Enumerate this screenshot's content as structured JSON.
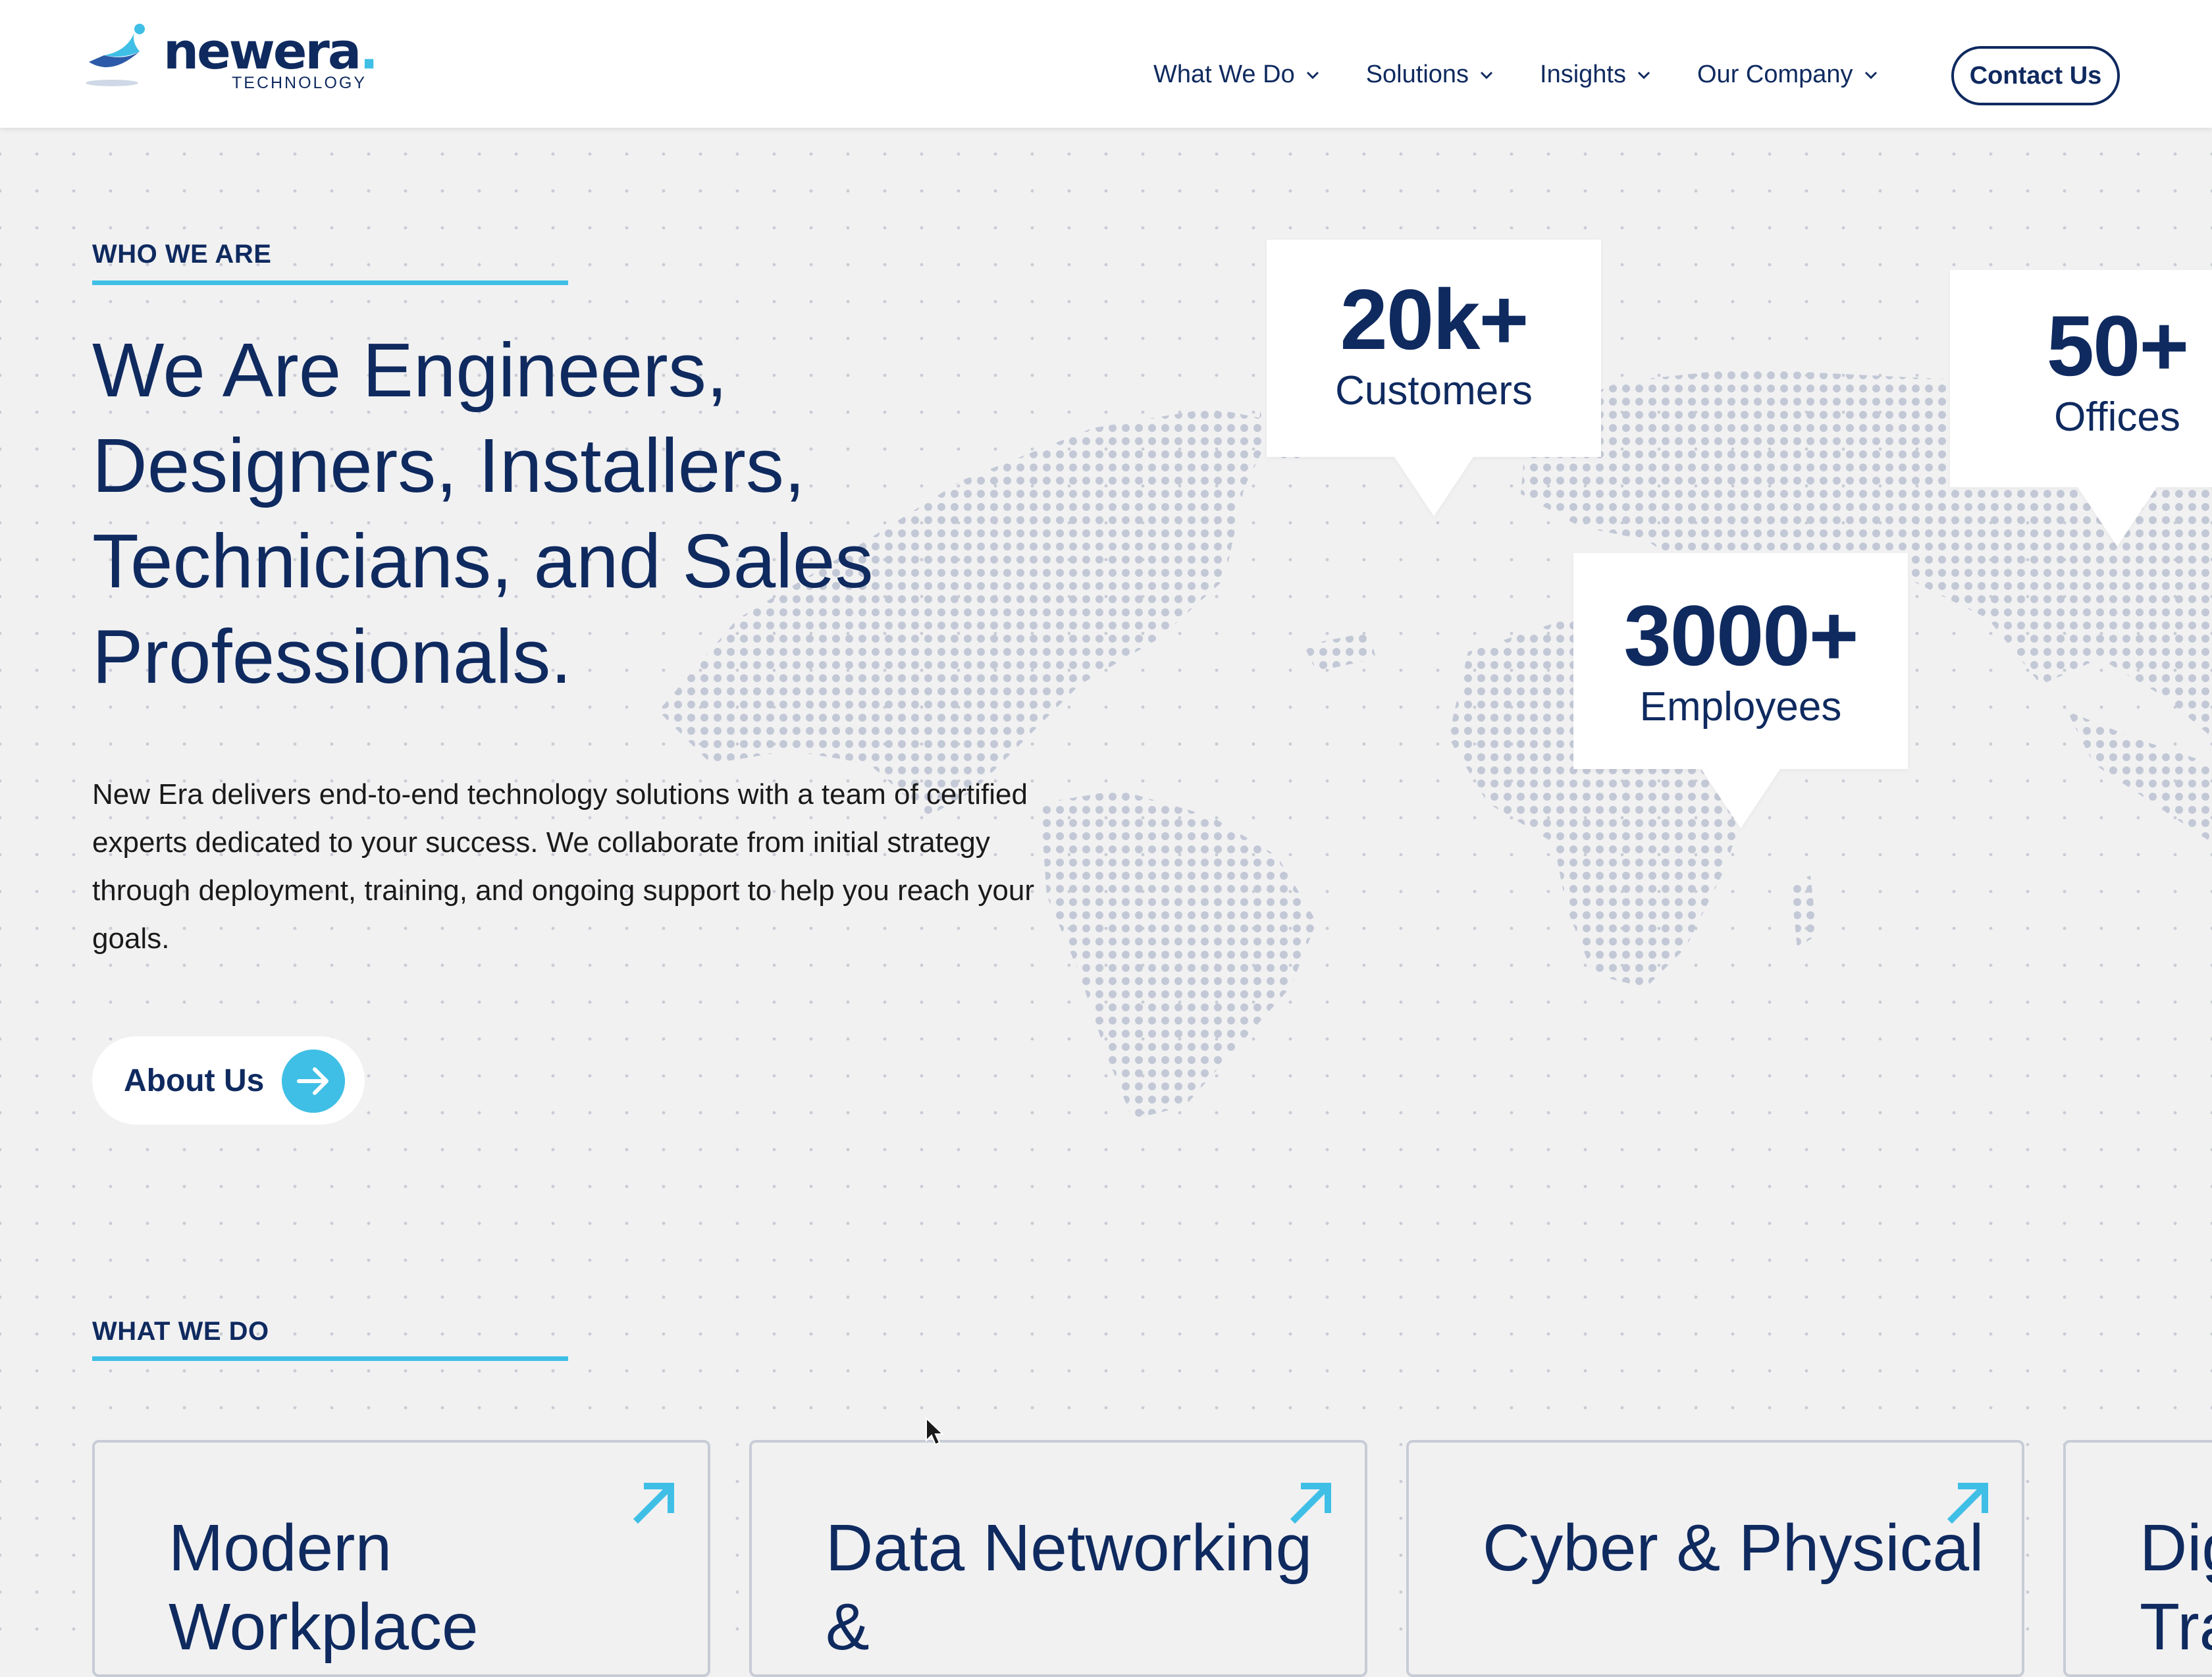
{
  "header": {
    "logo": {
      "word": "newera",
      "sub": "TECHNOLOGY"
    },
    "nav": [
      {
        "label": "What We Do"
      },
      {
        "label": "Solutions"
      },
      {
        "label": "Insights"
      },
      {
        "label": "Our Company"
      }
    ],
    "contact_label": "Contact Us"
  },
  "who_we_are": {
    "eyebrow": "WHO WE ARE",
    "title": "We Are Engineers, Designers, Installers, Technicians, and Sales Professionals.",
    "body": "New Era delivers end-to-end technology solutions with a team of certified experts dedicated to your success. We collaborate from initial strategy through deployment, training, and ongoing support to help you reach your goals.",
    "button_label": "About Us"
  },
  "stats": [
    {
      "value": "20k+",
      "label": "Customers"
    },
    {
      "value": "3000+",
      "label": "Employees"
    },
    {
      "value": "50+",
      "label": "Offices"
    }
  ],
  "what_we_do": {
    "eyebrow": "WHAT WE DO",
    "cards": [
      {
        "title": "Modern Workplace"
      },
      {
        "title": "Data Networking &"
      },
      {
        "title": "Cyber & Physical"
      },
      {
        "title": "Dig Tra"
      }
    ]
  },
  "colors": {
    "navy": "#0f2a5f",
    "accent": "#3fbfe6",
    "background": "#f1f1f2"
  },
  "icons": [
    "logo-mark",
    "chevron-down-icon",
    "arrow-right-icon",
    "arrow-up-right-icon",
    "cursor-icon",
    "world-map"
  ]
}
